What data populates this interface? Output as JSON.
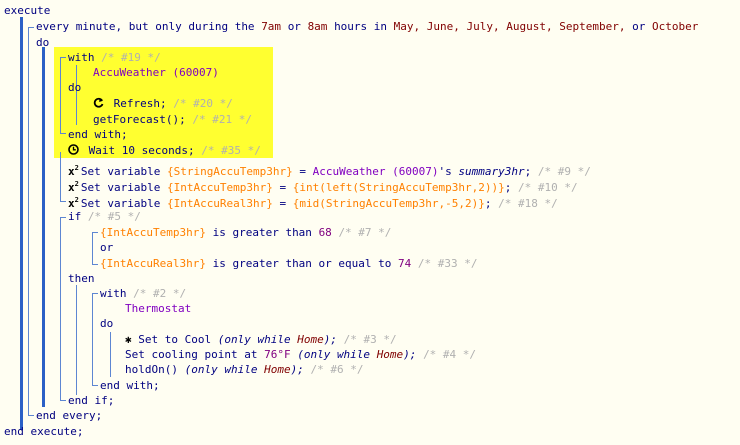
{
  "code": {
    "execute": "execute",
    "every_kw": "every",
    "every_text_1": "minute, but only during the",
    "every_time_1": "7am",
    "every_text_2": "or",
    "every_time_2": "8am",
    "every_text_3": "hours in",
    "months": "May, June, July, August, September,",
    "every_text_4": "or",
    "month_last": "October",
    "do": "do",
    "with_kw": "with",
    "with_cmt": "/* #19 */",
    "device_accu": "AccuWeather (60007)",
    "do_inner": "do",
    "refresh": "Refresh;",
    "refresh_cmt": "/* #20 */",
    "getforecast": "getForecast();",
    "getforecast_cmt": "/* #21 */",
    "end_with": "end with;",
    "wait": "Wait 10 seconds;",
    "wait_cmt": "/* #35 */",
    "setvar_kw": "Set variable",
    "var1": "{StringAccuTemp3hr}",
    "eq": "=",
    "var1_dev": "AccuWeather (60007)",
    "var1_attr_a": "'s",
    "var1_attr_b": "summary3hr",
    "semi": ";",
    "var1_cmt": "/* #9 */",
    "var2": "{IntAccuTemp3hr}",
    "var2_expr": "{int(left(StringAccuTemp3hr,2))}",
    "var2_cmt": "/* #10 */",
    "var3": "{IntAccuReal3hr}",
    "var3_expr": "{mid(StringAccuTemp3hr,-5,2)}",
    "var3_cmt": "/* #18 */",
    "if_kw": "if",
    "if_cmt": "/* #5 */",
    "cond1_var": "{IntAccuTemp3hr}",
    "cond1_op": "is greater than",
    "cond1_val": "68",
    "cond1_cmt": "/* #7 */",
    "or": "or",
    "cond2_var": "{IntAccuReal3hr}",
    "cond2_op": "is greater than or equal to",
    "cond2_val": "74",
    "cond2_cmt": "/* #33 */",
    "then": "then",
    "with2_cmt": "/* #2 */",
    "device_thermo": "Thermostat",
    "setcool_a": "Set to Cool",
    "only_while": "(only while",
    "home": "Home",
    "close_paren_semi": ");",
    "setcool_cmt": "/* #3 */",
    "setpoint_a": "Set cooling point at",
    "setpoint_val": "76°F",
    "setpoint_cmt": "/* #4 */",
    "holdon": "holdOn()",
    "holdon_cmt": "/* #6 */",
    "end_with2": "end with;",
    "end_if": "end if;",
    "end_every": "end every;",
    "end_execute": "end execute;"
  }
}
